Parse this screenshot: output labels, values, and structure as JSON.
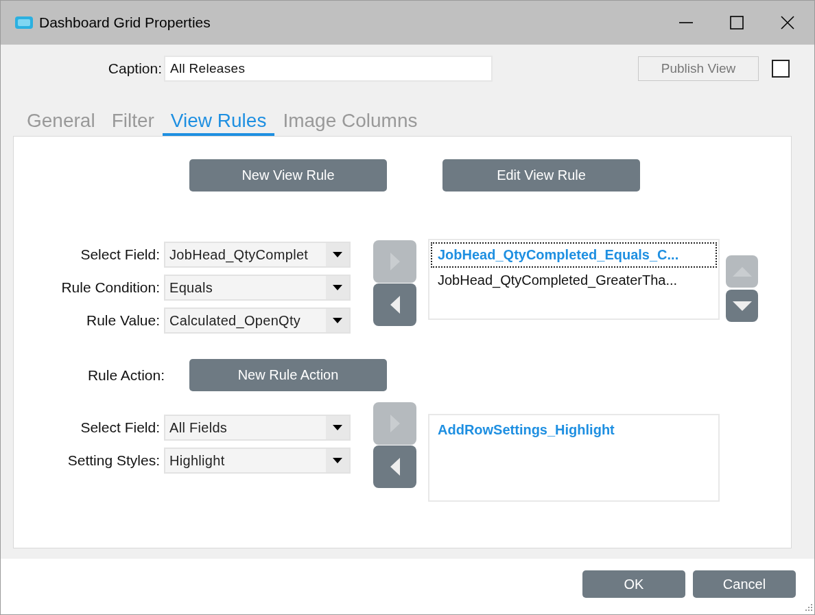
{
  "window": {
    "title": "Dashboard Grid Properties"
  },
  "caption": {
    "label": "Caption:",
    "value": "All Releases"
  },
  "publish_button": {
    "label": "Publish View",
    "disabled": true
  },
  "publish_checkbox": {
    "checked": false
  },
  "tabs": [
    {
      "label": "General",
      "selected": false
    },
    {
      "label": "Filter",
      "selected": false
    },
    {
      "label": "View Rules",
      "selected": true
    },
    {
      "label": "Image Columns",
      "selected": false
    }
  ],
  "rule_buttons": [
    {
      "label": "New View Rule"
    },
    {
      "label": "Edit View Rule"
    }
  ],
  "rule_fields": [
    {
      "label": "Select Field:",
      "value": "JobHead_QtyComplet"
    },
    {
      "label": "Rule Condition:",
      "value": "Equals"
    },
    {
      "label": "Rule Value:",
      "value": "Calculated_OpenQty"
    }
  ],
  "rule_transfer": [
    {
      "kind": "right",
      "disabled": true
    },
    {
      "kind": "left",
      "disabled": false
    }
  ],
  "rules_list": [
    {
      "label": "JobHead_QtyCompleted_Equals_C...",
      "selected": true,
      "focused": true
    },
    {
      "label": "JobHead_QtyCompleted_GreaterTha...",
      "selected": false,
      "focused": false
    }
  ],
  "order_buttons": [
    {
      "kind": "up",
      "disabled": true
    },
    {
      "kind": "down",
      "disabled": false
    }
  ],
  "action": {
    "label": "Rule Action:",
    "button": "New Rule Action"
  },
  "action_fields": [
    {
      "label": "Select Field:",
      "value": "All Fields"
    },
    {
      "label": "Setting Styles:",
      "value": "Highlight"
    }
  ],
  "action_transfer": [
    {
      "kind": "right",
      "disabled": true
    },
    {
      "kind": "left",
      "disabled": false
    }
  ],
  "actions_list": [
    {
      "label": "AddRowSettings_Highlight",
      "selected": true,
      "focused": false
    }
  ],
  "footer_buttons": [
    {
      "label": "OK"
    },
    {
      "label": "Cancel"
    }
  ]
}
